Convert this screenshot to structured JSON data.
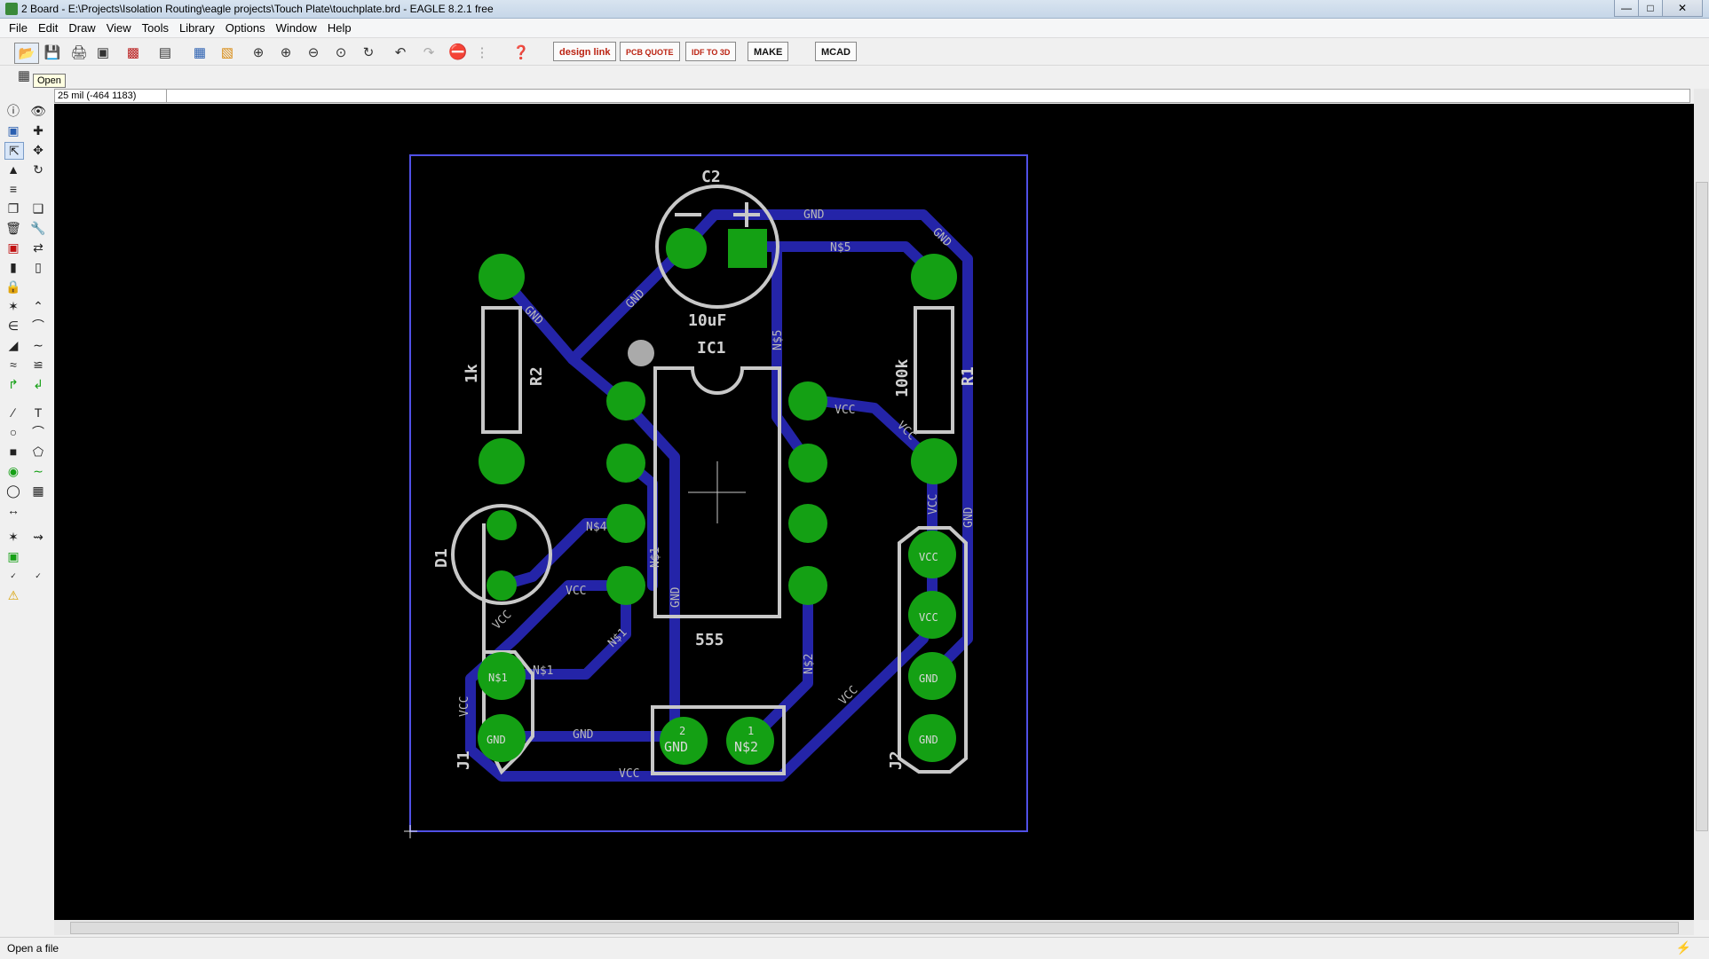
{
  "window": {
    "title": "2 Board - E:\\Projects\\Isolation Routing\\eagle projects\\Touch Plate\\touchplate.brd - EAGLE 8.2.1 free"
  },
  "menu": [
    "File",
    "Edit",
    "Draw",
    "View",
    "Tools",
    "Library",
    "Options",
    "Window",
    "Help"
  ],
  "toolbar": {
    "design_link": "design link",
    "pcb_quote": "PCB QUOTE",
    "idf_3d": "IDF TO 3D",
    "make": "MAKE",
    "mcad": "MCAD"
  },
  "tooltip": "Open",
  "coord": "25 mil (-464 1183)",
  "status": "Open a file",
  "board": {
    "components": {
      "c2": "C2",
      "c2_value": "10uF",
      "ic1": "IC1",
      "ic1_value": "555",
      "r1": "R1",
      "r1_value": "100k",
      "r2": "R2",
      "r2_value": "1k",
      "d1": "D1",
      "j1": "J1",
      "j2": "J2"
    },
    "signals": {
      "gnd": "GND",
      "vcc": "VCC",
      "n5": "N$5",
      "n4": "N$4",
      "n1": "N$1",
      "n2": "N$2"
    },
    "pins": {
      "one": "1",
      "two": "2"
    },
    "colors": {
      "trace": "#2424a8",
      "pad": "#14a014",
      "silk": "#c8c8c8",
      "outline": "#5050e6",
      "background": "#000000"
    }
  }
}
